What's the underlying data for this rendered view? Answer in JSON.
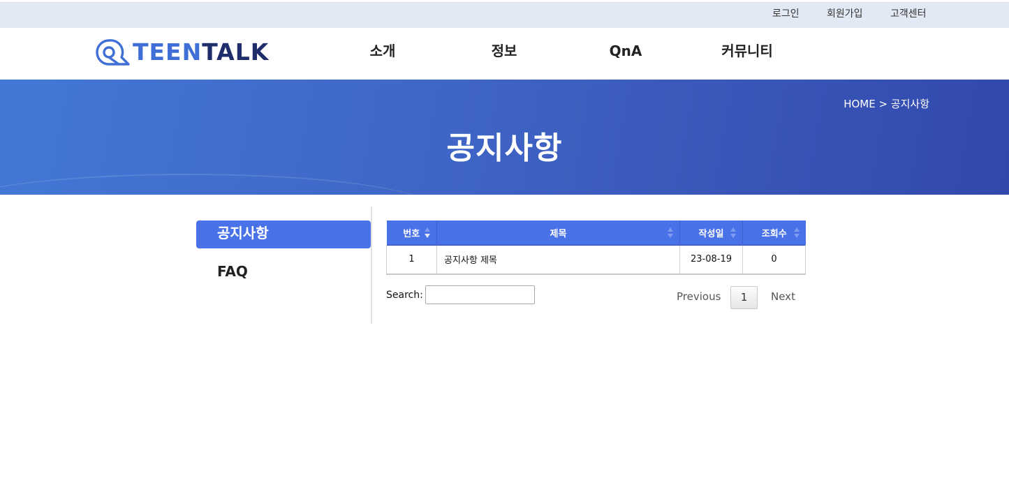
{
  "utility": {
    "login": "로그인",
    "signup": "회원가입",
    "support": "고객센터"
  },
  "logo": {
    "text_a": "TEEN",
    "text_b": "TA",
    "text_c": "LK"
  },
  "nav": [
    {
      "label": "소개"
    },
    {
      "label": "정보"
    },
    {
      "label": "QnA"
    },
    {
      "label": "커뮤니티"
    }
  ],
  "banner": {
    "breadcrumb": "HOME > 공지사항",
    "title": "공지사항"
  },
  "sidebar": {
    "items": [
      {
        "label": "공지사항",
        "active": true
      },
      {
        "label": "FAQ",
        "active": false
      }
    ]
  },
  "table": {
    "headers": [
      "번호",
      "제목",
      "작성일",
      "조회수"
    ],
    "rows": [
      {
        "no": "1",
        "title": "공지사항 제목",
        "date": "23-08-19",
        "views": "0"
      }
    ]
  },
  "search": {
    "label": "Search:",
    "value": ""
  },
  "paging": {
    "previous": "Previous",
    "current": "1",
    "next": "Next"
  },
  "colors": {
    "accent": "#4a72e8",
    "banner_start": "#4478d6",
    "banner_end": "#3248ac",
    "topbar": "#e3e9f4"
  }
}
